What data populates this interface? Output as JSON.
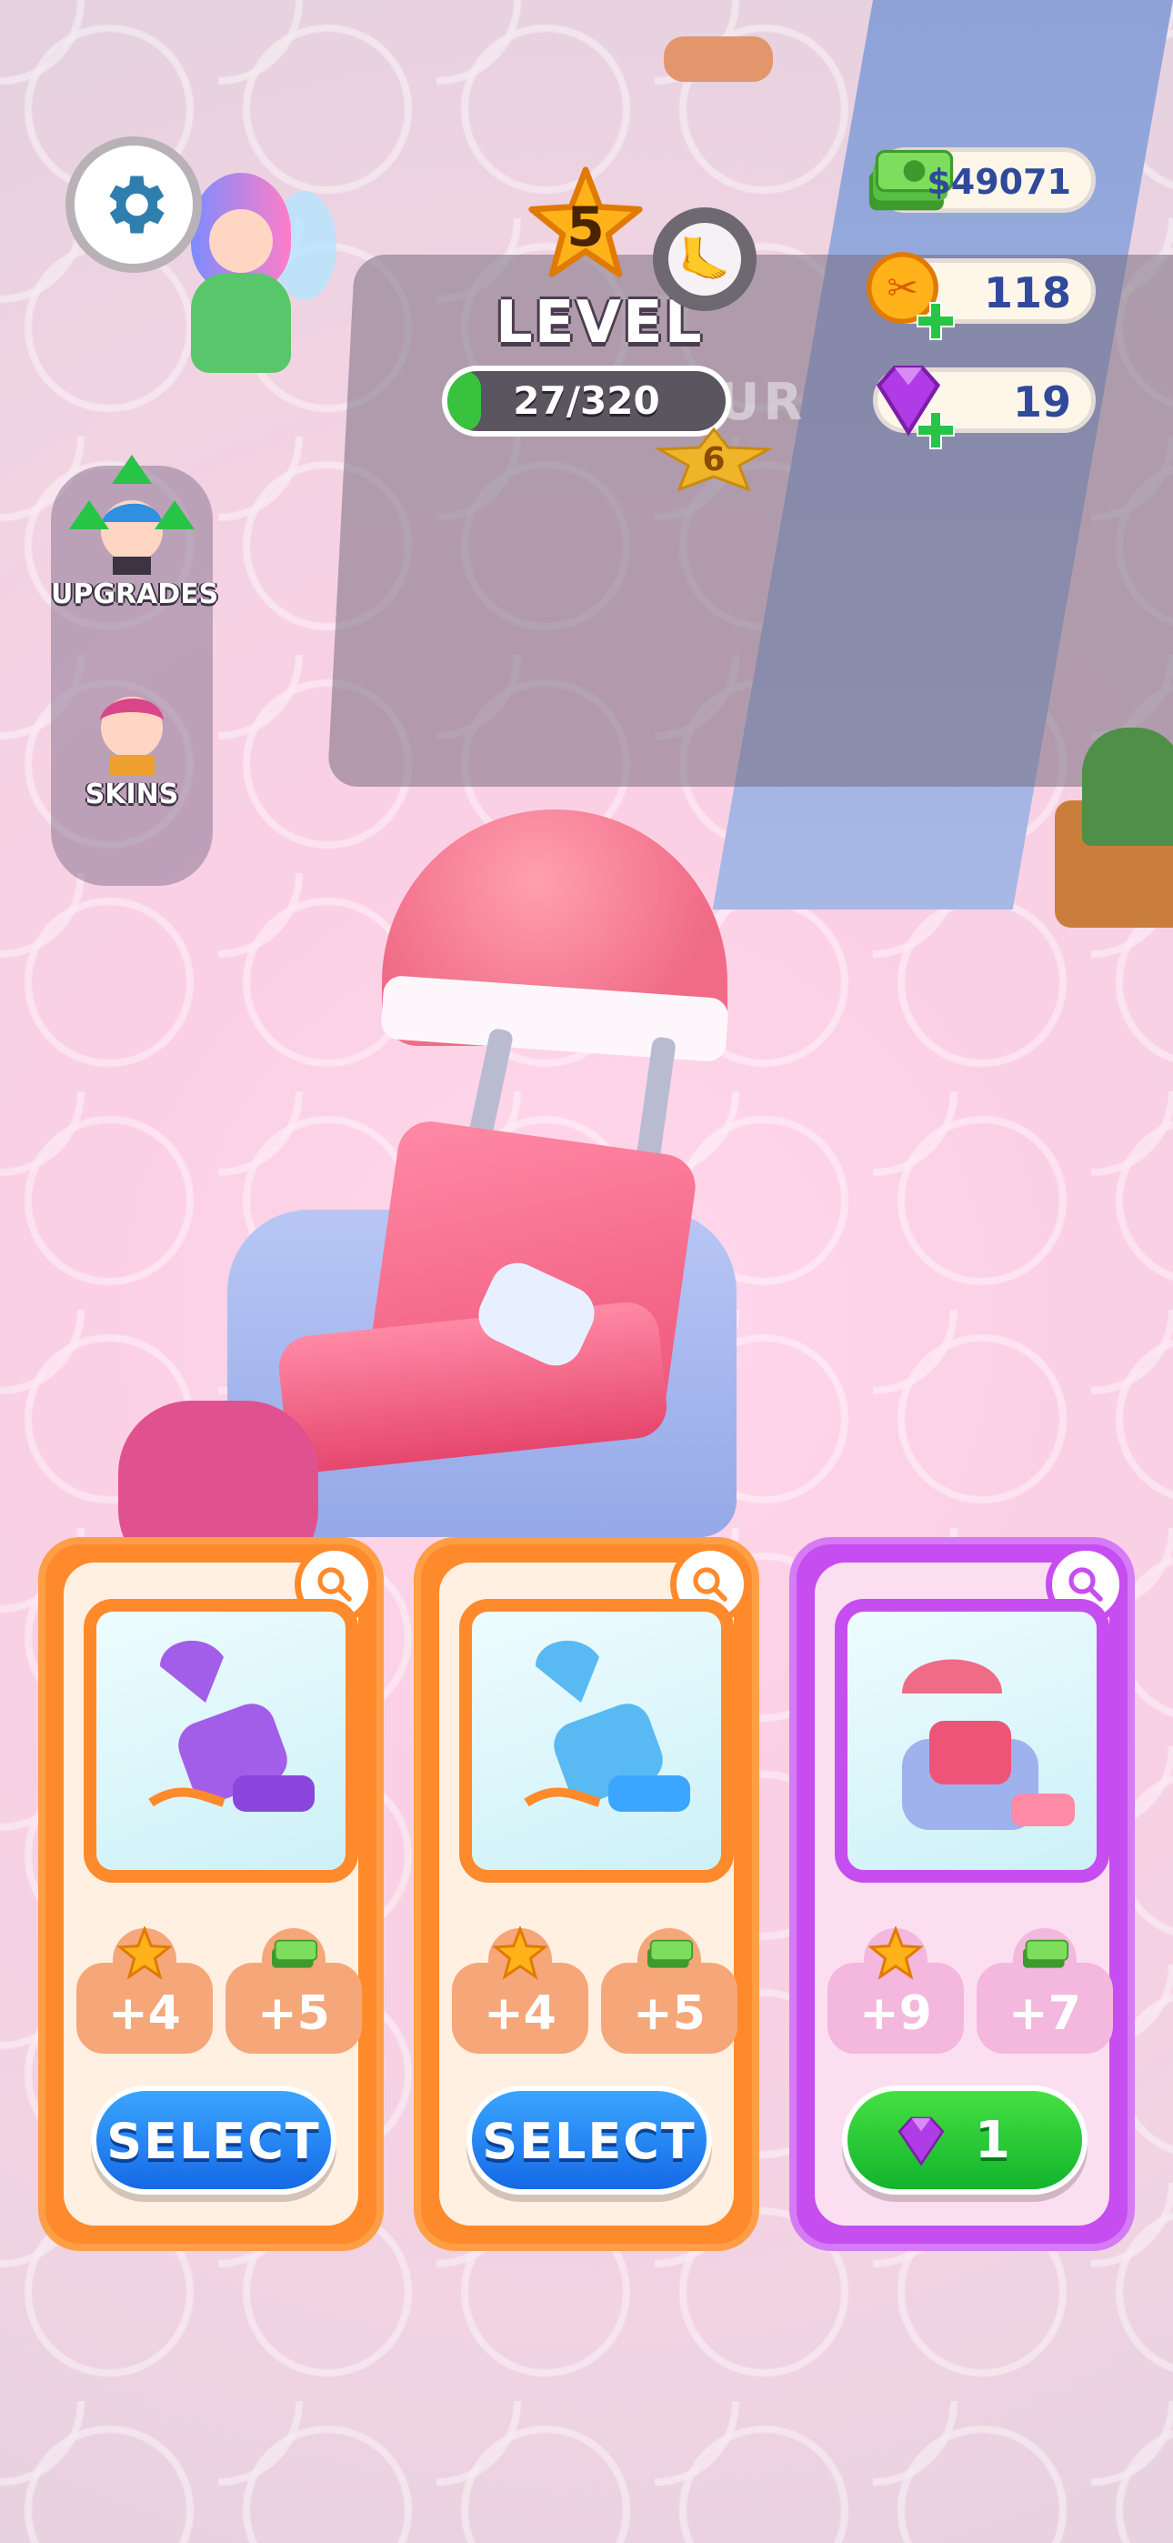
{
  "hud": {
    "level": {
      "number": "5",
      "label": "LEVEL",
      "progress_text": "27/320",
      "progress_fraction": 0.084,
      "next_level": "6"
    },
    "currencies": [
      {
        "name": "cash",
        "value": "$49071",
        "icon": "cash-stack-icon",
        "has_plus": false
      },
      {
        "name": "scissor-coins",
        "value": "118",
        "icon": "scissors-coin-icon",
        "has_plus": true
      },
      {
        "name": "gems",
        "value": "19",
        "icon": "purple-gem-icon",
        "has_plus": true
      }
    ],
    "area_icon": "foot-icon",
    "area_sign": "ICUR"
  },
  "side_menu": {
    "items": [
      {
        "label": "UPGRADES",
        "icon": "upgrades-avatar-icon"
      },
      {
        "label": "SKINS",
        "icon": "skins-avatar-icon"
      }
    ]
  },
  "cards": [
    {
      "variant": "orange",
      "item_icon": "purple-salon-chair-icon",
      "stat_star": "+4",
      "stat_cash": "+5",
      "action_label": "SELECT",
      "action_type": "select"
    },
    {
      "variant": "orange",
      "item_icon": "blue-salon-chair-icon",
      "stat_star": "+4",
      "stat_cash": "+5",
      "action_label": "SELECT",
      "action_type": "select"
    },
    {
      "variant": "purple",
      "item_icon": "pink-pedicure-chair-icon",
      "stat_star": "+9",
      "stat_cash": "+7",
      "action_label": "1",
      "action_type": "buy-gem"
    }
  ],
  "colors": {
    "orange": "#ff8a2c",
    "purple": "#c64df0",
    "select_blue": "#1f7ff0",
    "buy_green": "#1fc136",
    "text_blue": "#2f4a9a"
  }
}
